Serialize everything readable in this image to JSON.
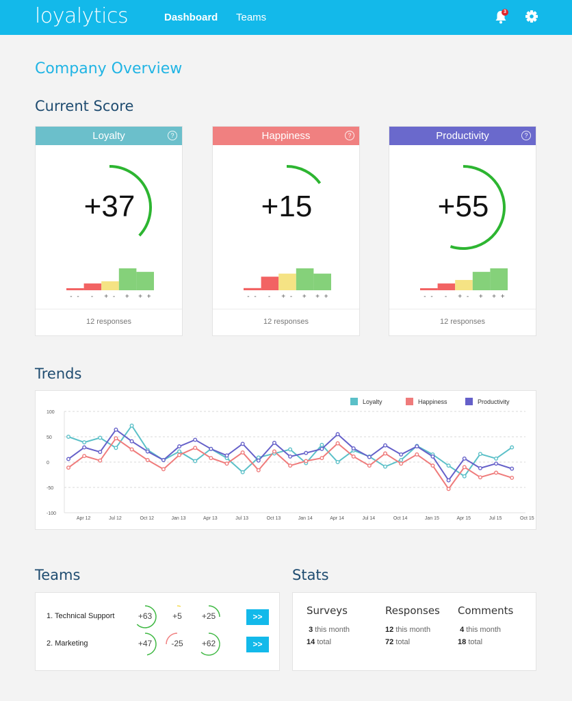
{
  "header": {
    "logo": "loyalytics",
    "nav": [
      {
        "label": "Dashboard",
        "active": true
      },
      {
        "label": "Teams",
        "active": false
      }
    ],
    "notifications_count": "3",
    "icons": [
      "bell-icon",
      "gear-icon"
    ]
  },
  "page_title": "Company Overview",
  "current_score": {
    "title": "Current Score",
    "bar_labels": [
      "- -",
      "-",
      "+ -",
      "+",
      "+ +"
    ],
    "bar_colors": [
      "#f26363",
      "#f26363",
      "#f5e384",
      "#85d17a",
      "#85d17a"
    ],
    "gauge_color": "#2db531",
    "cards": [
      {
        "name": "Loyalty",
        "color": "#6bbfcb",
        "score": "+37",
        "score_value": 37,
        "distribution_rel": [
          0.08,
          0.31,
          0.41,
          1.0,
          0.84
        ],
        "responses": "12 responses"
      },
      {
        "name": "Happiness",
        "color": "#f08080",
        "score": "+15",
        "score_value": 15,
        "distribution_rel": [
          0.1,
          0.62,
          0.76,
          1.0,
          0.76
        ],
        "responses": "12 responses"
      },
      {
        "name": "Productivity",
        "color": "#6a69cc",
        "score": "+55",
        "score_value": 55,
        "distribution_rel": [
          0.06,
          0.31,
          0.47,
          0.84,
          1.0
        ],
        "responses": "12 responses"
      }
    ]
  },
  "trends": {
    "title": "Trends"
  },
  "chart_data": {
    "type": "line",
    "title": "",
    "xlabel": "",
    "ylabel": "",
    "ylim": [
      -100,
      100
    ],
    "yticks": [
      100,
      50,
      0,
      -50,
      -100
    ],
    "grid": true,
    "legend": "top-right",
    "x_tick_labels": [
      "Apr 12",
      "Jul 12",
      "Oct 12",
      "Jan 13",
      "Apr 13",
      "Jul 13",
      "Oct 13",
      "Jan 14",
      "Apr 14",
      "Jul 14",
      "Oct 14",
      "Jan 15",
      "Apr 15",
      "Jul 15",
      "Oct 15"
    ],
    "point_count": 29,
    "series": [
      {
        "name": "Loyalty",
        "color": "#5bc0c8",
        "values": [
          50,
          39,
          48,
          28,
          72,
          24,
          4,
          21,
          2,
          26,
          8,
          -20,
          9,
          17,
          25,
          -2,
          34,
          0,
          23,
          11,
          -9,
          4,
          32,
          15,
          -7,
          -28,
          16,
          7,
          29
        ]
      },
      {
        "name": "Happiness",
        "color": "#ef7b7b",
        "values": [
          -11,
          12,
          3,
          47,
          25,
          4,
          -14,
          14,
          28,
          8,
          -3,
          19,
          -16,
          21,
          -7,
          2,
          8,
          37,
          11,
          -7,
          17,
          -3,
          15,
          -7,
          -53,
          -10,
          -30,
          -21,
          -31
        ]
      },
      {
        "name": "Productivity",
        "color": "#6560c9",
        "values": [
          6,
          29,
          20,
          64,
          41,
          21,
          4,
          31,
          44,
          26,
          13,
          36,
          3,
          38,
          11,
          18,
          26,
          55,
          27,
          10,
          33,
          15,
          31,
          11,
          -36,
          7,
          -12,
          -3,
          -13
        ]
      }
    ]
  },
  "teams": {
    "title": "Teams",
    "go_label": ">>",
    "rows": [
      {
        "name": "1. Technical Support",
        "scores": [
          {
            "text": "+63",
            "value": 63
          },
          {
            "text": "+5",
            "value": 5
          },
          {
            "text": "+25",
            "value": 25
          }
        ]
      },
      {
        "name": "2. Marketing",
        "scores": [
          {
            "text": "+47",
            "value": 47
          },
          {
            "text": "-25",
            "value": -25
          },
          {
            "text": "+62",
            "value": 62
          }
        ]
      }
    ]
  },
  "stats": {
    "title": "Stats",
    "columns": [
      {
        "title": "Surveys",
        "month_num": "3",
        "month_label": "this month",
        "total_num": "14",
        "total_label": "total"
      },
      {
        "title": "Responses",
        "month_num": "12",
        "month_label": "this month",
        "total_num": "72",
        "total_label": "total"
      },
      {
        "title": "Comments",
        "month_num": "4",
        "month_label": "this month",
        "total_num": "18",
        "total_label": "total"
      }
    ]
  }
}
